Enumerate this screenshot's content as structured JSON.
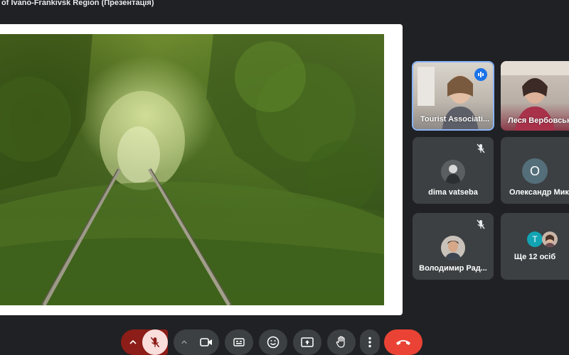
{
  "window": {
    "title": "of Ivano-Frankivsk Region (Презентація)"
  },
  "presentation": {
    "slide_description_colors": {
      "accent": "#6d8a2e"
    }
  },
  "participants": [
    {
      "name": "Tourist Associati...",
      "type": "video",
      "speaking": true
    },
    {
      "name": "Леся Вербовськ...",
      "type": "video",
      "speaking": false
    },
    {
      "name": "dima vatseba",
      "type": "avatar",
      "muted": true
    },
    {
      "name": "Олександр Мик...",
      "type": "letter",
      "letter": "O",
      "muted": true
    },
    {
      "name": "Володимир Рад...",
      "type": "avatar",
      "muted": true
    },
    {
      "name": "Ще 12 осіб",
      "type": "more",
      "letter": "T"
    }
  ],
  "toolbar": {
    "buttons": [
      {
        "name": "mic-options",
        "icon": "chevron-up-icon"
      },
      {
        "name": "mic-muted",
        "icon": "mic-off-icon"
      },
      {
        "name": "camera-options",
        "icon": "chevron-up-icon"
      },
      {
        "name": "camera",
        "icon": "camera-icon"
      },
      {
        "name": "captions",
        "icon": "captions-icon"
      },
      {
        "name": "reactions",
        "icon": "emoji-icon"
      },
      {
        "name": "present",
        "icon": "present-icon"
      },
      {
        "name": "raise-hand",
        "icon": "hand-icon"
      },
      {
        "name": "more-options",
        "icon": "more-vert-icon"
      },
      {
        "name": "leave-call",
        "icon": "call-end-icon"
      }
    ],
    "colors": {
      "muted_bg": "#f28b82",
      "leave_bg": "#ea4335"
    }
  }
}
